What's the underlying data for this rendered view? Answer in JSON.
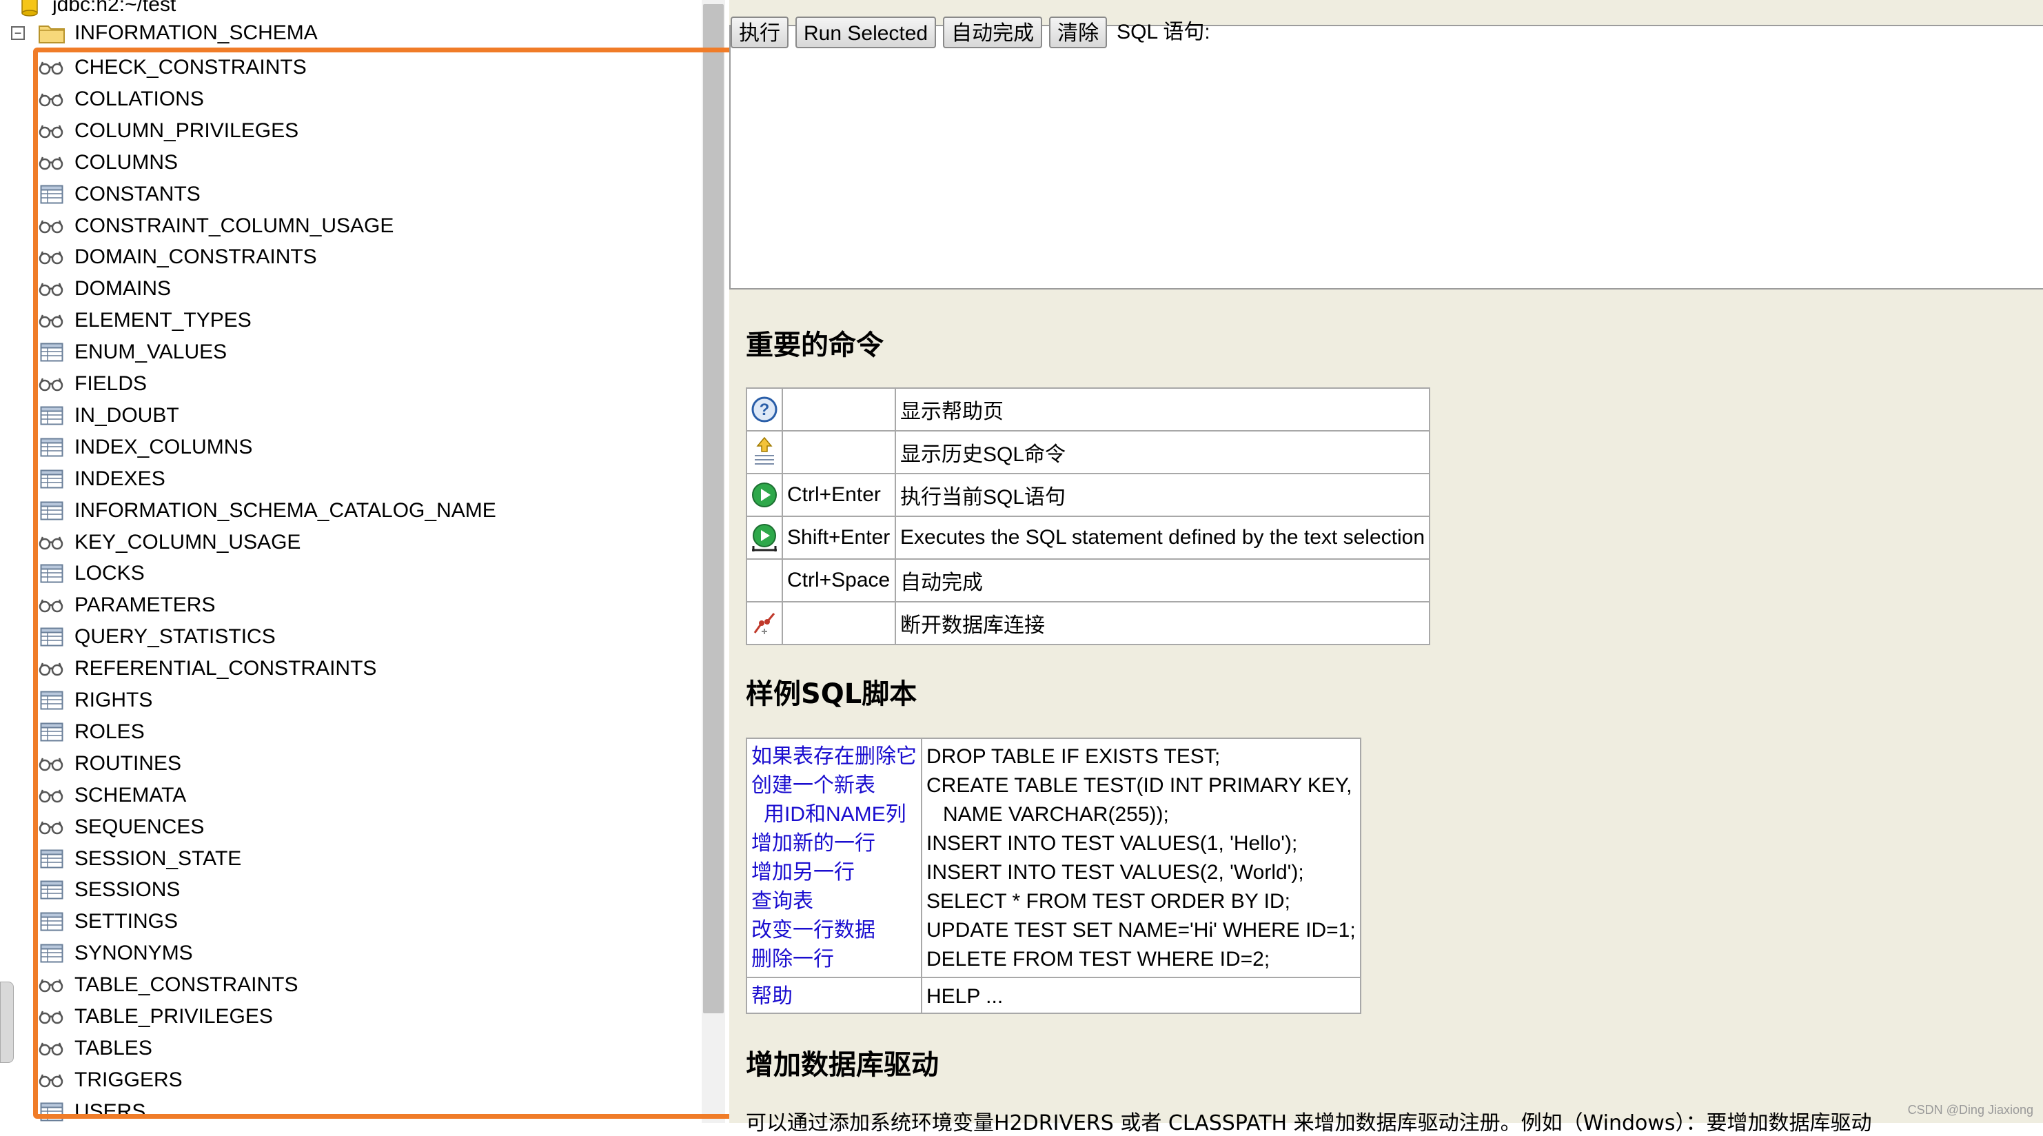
{
  "tree": {
    "connection_label": "jdbc:h2:~/test",
    "schema_label": "INFORMATION_SCHEMA",
    "toggle_symbol": "−",
    "items": [
      {
        "label": "CHECK_CONSTRAINTS",
        "icon": "glasses-icon"
      },
      {
        "label": "COLLATIONS",
        "icon": "glasses-icon"
      },
      {
        "label": "COLUMN_PRIVILEGES",
        "icon": "glasses-icon"
      },
      {
        "label": "COLUMNS",
        "icon": "glasses-icon"
      },
      {
        "label": "CONSTANTS",
        "icon": "table-icon"
      },
      {
        "label": "CONSTRAINT_COLUMN_USAGE",
        "icon": "glasses-icon"
      },
      {
        "label": "DOMAIN_CONSTRAINTS",
        "icon": "glasses-icon"
      },
      {
        "label": "DOMAINS",
        "icon": "glasses-icon"
      },
      {
        "label": "ELEMENT_TYPES",
        "icon": "glasses-icon"
      },
      {
        "label": "ENUM_VALUES",
        "icon": "table-icon"
      },
      {
        "label": "FIELDS",
        "icon": "glasses-icon"
      },
      {
        "label": "IN_DOUBT",
        "icon": "table-icon"
      },
      {
        "label": "INDEX_COLUMNS",
        "icon": "table-icon"
      },
      {
        "label": "INDEXES",
        "icon": "table-icon"
      },
      {
        "label": "INFORMATION_SCHEMA_CATALOG_NAME",
        "icon": "table-icon"
      },
      {
        "label": "KEY_COLUMN_USAGE",
        "icon": "glasses-icon"
      },
      {
        "label": "LOCKS",
        "icon": "table-icon"
      },
      {
        "label": "PARAMETERS",
        "icon": "glasses-icon"
      },
      {
        "label": "QUERY_STATISTICS",
        "icon": "table-icon"
      },
      {
        "label": "REFERENTIAL_CONSTRAINTS",
        "icon": "glasses-icon"
      },
      {
        "label": "RIGHTS",
        "icon": "table-icon"
      },
      {
        "label": "ROLES",
        "icon": "table-icon"
      },
      {
        "label": "ROUTINES",
        "icon": "glasses-icon"
      },
      {
        "label": "SCHEMATA",
        "icon": "glasses-icon"
      },
      {
        "label": "SEQUENCES",
        "icon": "glasses-icon"
      },
      {
        "label": "SESSION_STATE",
        "icon": "table-icon"
      },
      {
        "label": "SESSIONS",
        "icon": "table-icon"
      },
      {
        "label": "SETTINGS",
        "icon": "table-icon"
      },
      {
        "label": "SYNONYMS",
        "icon": "table-icon"
      },
      {
        "label": "TABLE_CONSTRAINTS",
        "icon": "glasses-icon"
      },
      {
        "label": "TABLE_PRIVILEGES",
        "icon": "glasses-icon"
      },
      {
        "label": "TABLES",
        "icon": "glasses-icon"
      },
      {
        "label": "TRIGGERS",
        "icon": "glasses-icon"
      },
      {
        "label": "USERS",
        "icon": "table-icon"
      }
    ]
  },
  "toolbar": {
    "execute_label": "执行",
    "run_selected_label": "Run Selected",
    "autocomplete_label": "自动完成",
    "clear_label": "清除",
    "sql_label": "SQL 语句:"
  },
  "commands": {
    "title": "重要的命令",
    "rows": [
      {
        "icon": "help-icon",
        "shortcut": "",
        "description": "显示帮助页"
      },
      {
        "icon": "history-icon",
        "shortcut": "",
        "description": "显示历史SQL命令"
      },
      {
        "icon": "run-icon",
        "shortcut": "Ctrl+Enter",
        "description": "执行当前SQL语句"
      },
      {
        "icon": "run-selected-icon",
        "shortcut": "Shift+Enter",
        "description": "Executes the SQL statement defined by the text selection"
      },
      {
        "icon": "",
        "shortcut": "Ctrl+Space",
        "description": "自动完成"
      },
      {
        "icon": "disconnect-icon",
        "shortcut": "",
        "description": "断开数据库连接"
      }
    ]
  },
  "samples": {
    "title": "样例SQL脚本",
    "rows": [
      {
        "label": "如果表存在删除它",
        "code": "DROP TABLE IF EXISTS TEST;"
      },
      {
        "label": "创建一个新表",
        "code": "CREATE TABLE TEST(ID INT PRIMARY KEY,"
      },
      {
        "label": "用ID和NAME列",
        "code": "NAME VARCHAR(255));"
      },
      {
        "label": "增加新的一行",
        "code": "INSERT INTO TEST VALUES(1, 'Hello');"
      },
      {
        "label": "增加另一行",
        "code": "INSERT INTO TEST VALUES(2, 'World');"
      },
      {
        "label": "查询表",
        "code": "SELECT * FROM TEST ORDER BY ID;"
      },
      {
        "label": "改变一行数据",
        "code": "UPDATE TEST SET NAME='Hi' WHERE ID=1;"
      },
      {
        "label": "删除一行",
        "code": "DELETE FROM TEST WHERE ID=2;"
      }
    ],
    "help_label": "帮助",
    "help_code": "HELP ..."
  },
  "drivers": {
    "title": "增加数据库驱动",
    "text": "可以通过添加系统环境变量H2DRIVERS 或者 CLASSPATH 来增加数据库驱动注册。例如（Windows）：要增加数据库驱动"
  },
  "watermark": "CSDN @Ding Jiaxiong",
  "colors": {
    "highlight": "#f07c28",
    "link": "#1a0dcf",
    "right_background": "#efede0"
  }
}
